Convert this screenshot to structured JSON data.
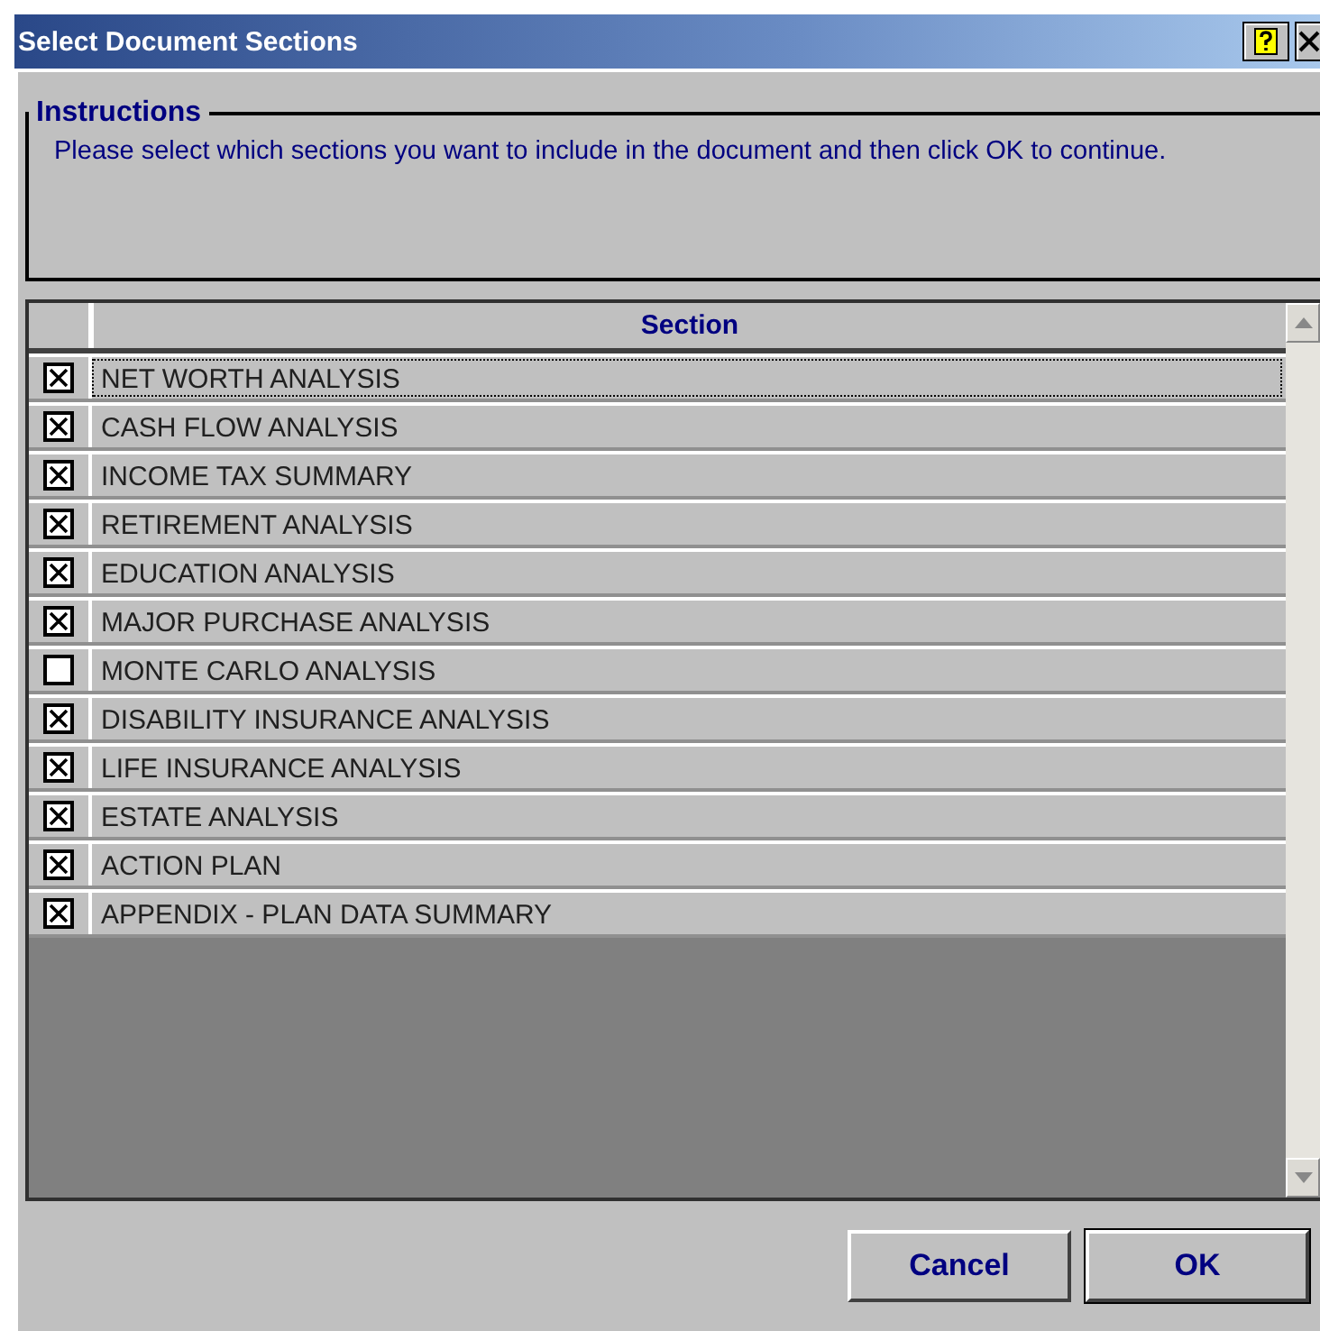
{
  "window": {
    "title": "Select Document Sections"
  },
  "instructions": {
    "legend": "Instructions",
    "text": "Please select which sections you want to include in the document and then click OK to continue."
  },
  "table": {
    "columns": [
      "Section"
    ],
    "rows": [
      {
        "section": "NET WORTH ANALYSIS",
        "checked": true,
        "selected": true
      },
      {
        "section": "CASH FLOW ANALYSIS",
        "checked": true,
        "selected": false
      },
      {
        "section": "INCOME TAX SUMMARY",
        "checked": true,
        "selected": false
      },
      {
        "section": "RETIREMENT ANALYSIS",
        "checked": true,
        "selected": false
      },
      {
        "section": "EDUCATION ANALYSIS",
        "checked": true,
        "selected": false
      },
      {
        "section": "MAJOR PURCHASE ANALYSIS",
        "checked": true,
        "selected": false
      },
      {
        "section": "MONTE CARLO ANALYSIS",
        "checked": false,
        "selected": false
      },
      {
        "section": "DISABILITY INSURANCE ANALYSIS",
        "checked": true,
        "selected": false
      },
      {
        "section": "LIFE INSURANCE ANALYSIS",
        "checked": true,
        "selected": false
      },
      {
        "section": "ESTATE ANALYSIS",
        "checked": true,
        "selected": false
      },
      {
        "section": "ACTION PLAN",
        "checked": true,
        "selected": false
      },
      {
        "section": "APPENDIX - PLAN DATA SUMMARY",
        "checked": true,
        "selected": false
      }
    ]
  },
  "buttons": [
    {
      "label": "Cancel",
      "default": false
    },
    {
      "label": "OK",
      "default": true
    }
  ]
}
